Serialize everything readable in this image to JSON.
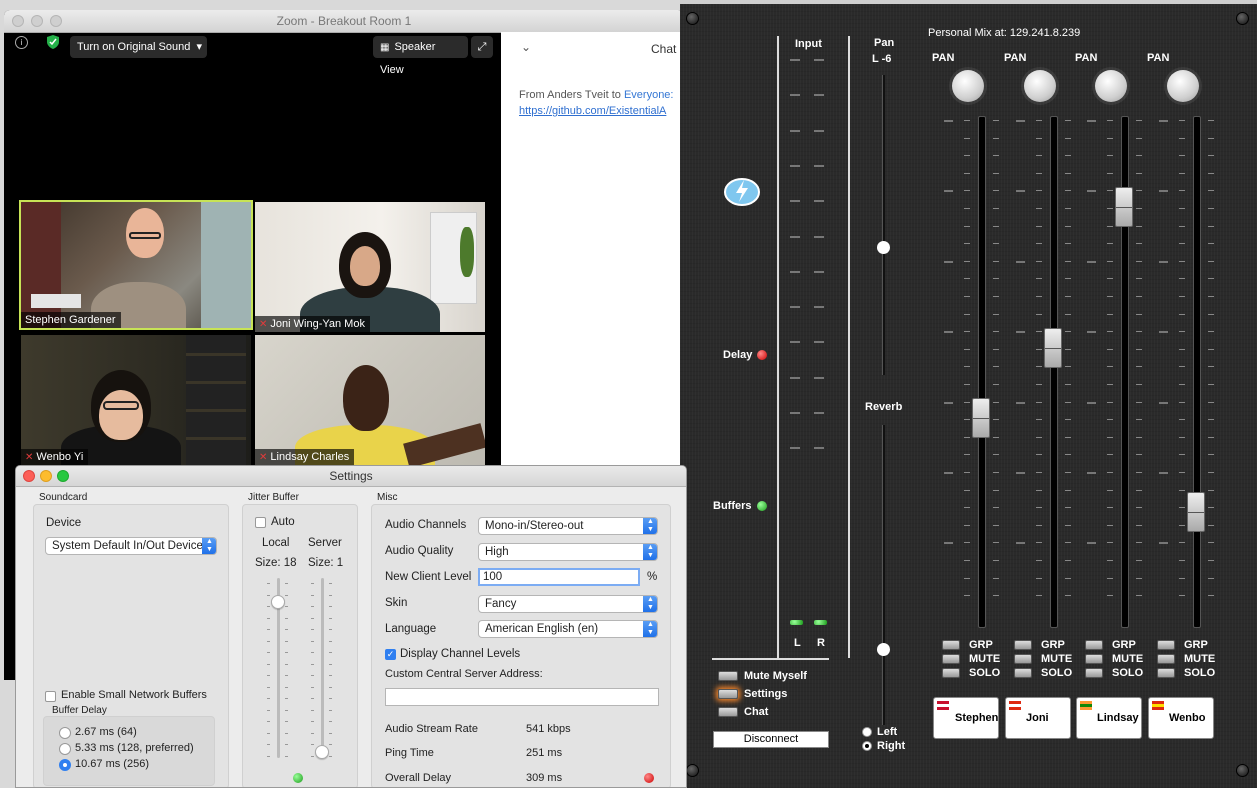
{
  "zoom": {
    "window_title": "Zoom - Breakout Room 1",
    "original_sound_label": "Turn on Original Sound",
    "speaker_view_label": "Speaker View",
    "participants": [
      {
        "name": "Stephen Gardener",
        "muted": false,
        "active": true
      },
      {
        "name": "Joni Wing-Yan Mok",
        "muted": true
      },
      {
        "name": "Wenbo Yi",
        "muted": true
      },
      {
        "name": "Lindsay Charles",
        "muted": true
      }
    ],
    "chat": {
      "title": "Chat",
      "from_text": "From Anders Tveit to",
      "to_text": "Everyone:",
      "link": "https://github.com/ExistentialA"
    }
  },
  "mixer": {
    "personal_mix": "Personal Mix at: 129.241.8.239",
    "input_label": "Input",
    "l_label": "L",
    "r_label": "R",
    "pan_label": "Pan",
    "pan_value": "L -6",
    "reverb_label": "Reverb",
    "left_label": "Left",
    "right_label": "Right",
    "delay_label": "Delay",
    "buffers_label": "Buffers",
    "mute_myself_label": "Mute Myself",
    "settings_label": "Settings",
    "chat_label": "Chat",
    "disconnect_label": "Disconnect",
    "channels": [
      {
        "name": "Stephen",
        "pan_label": "PAN",
        "grp": "GRP",
        "mute": "MUTE",
        "solo": "SOLO"
      },
      {
        "name": "Joni",
        "pan_label": "PAN",
        "grp": "GRP",
        "mute": "MUTE",
        "solo": "SOLO"
      },
      {
        "name": "Lindsay",
        "pan_label": "PAN",
        "grp": "GRP",
        "mute": "MUTE",
        "solo": "SOLO"
      },
      {
        "name": "Wenbo",
        "pan_label": "PAN",
        "grp": "GRP",
        "mute": "MUTE",
        "solo": "SOLO"
      }
    ],
    "fader_levels": [
      0.4,
      0.55,
      0.85,
      0.2
    ]
  },
  "settings": {
    "title": "Settings",
    "soundcard": {
      "group_label": "Soundcard",
      "device_label": "Device",
      "device_value": "System Default In/Out Devices",
      "small_buffers_label": "Enable Small Network Buffers",
      "buffer_delay_label": "Buffer Delay",
      "buffer_options": [
        "2.67 ms (64)",
        "5.33 ms (128, preferred)",
        "10.67 ms (256)"
      ],
      "buffer_selected": 2
    },
    "jitter": {
      "group_label": "Jitter Buffer",
      "auto_label": "Auto",
      "local_label": "Local",
      "server_label": "Server",
      "local_size": "Size: 18",
      "server_size": "Size: 1"
    },
    "misc": {
      "group_label": "Misc",
      "audio_channels_label": "Audio Channels",
      "audio_channels_value": "Mono-in/Stereo-out",
      "audio_quality_label": "Audio Quality",
      "audio_quality_value": "High",
      "new_client_label": "New Client Level",
      "new_client_value": "100",
      "percent": "%",
      "skin_label": "Skin",
      "skin_value": "Fancy",
      "language_label": "Language",
      "language_value": "American English (en)",
      "display_levels_label": "Display Channel Levels",
      "central_server_label": "Custom Central Server Address:",
      "central_server_value": "",
      "stream_rate_label": "Audio Stream Rate",
      "stream_rate_value": "541 kbps",
      "ping_label": "Ping Time",
      "ping_value": "251 ms",
      "overall_delay_label": "Overall Delay",
      "overall_delay_value": "309 ms"
    }
  }
}
